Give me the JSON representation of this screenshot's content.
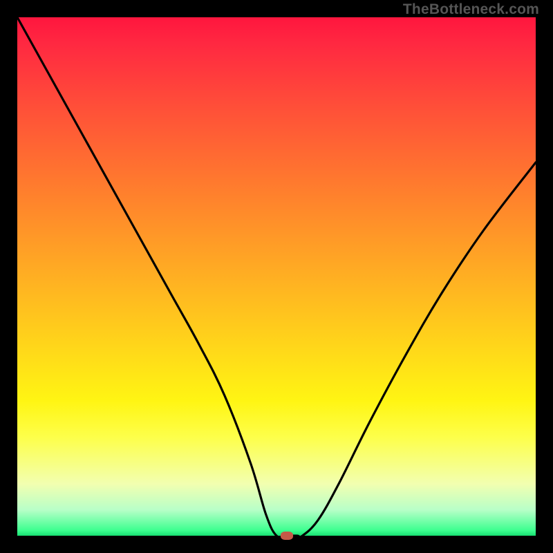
{
  "watermark": "TheBottleneck.com",
  "chart_data": {
    "type": "line",
    "title": "",
    "xlabel": "",
    "ylabel": "",
    "xlim": [
      0,
      100
    ],
    "ylim": [
      0,
      100
    ],
    "grid": false,
    "gradient": {
      "top": "#ff163e",
      "mid": "#ffcc1c",
      "bottom": "#18e072"
    },
    "series": [
      {
        "name": "bottleneck-curve",
        "x": [
          0,
          5,
          10,
          15,
          20,
          25,
          30,
          35,
          40,
          45,
          48,
          50,
          52,
          54,
          55,
          58,
          62,
          68,
          75,
          82,
          90,
          100
        ],
        "y": [
          100,
          91,
          82,
          73,
          64,
          55,
          46,
          37,
          27,
          14,
          4,
          0,
          0,
          0,
          0,
          3,
          10,
          22,
          35,
          47,
          59,
          72
        ]
      }
    ],
    "marker": {
      "x": 52,
      "y": 0,
      "color": "#c55a48"
    }
  }
}
